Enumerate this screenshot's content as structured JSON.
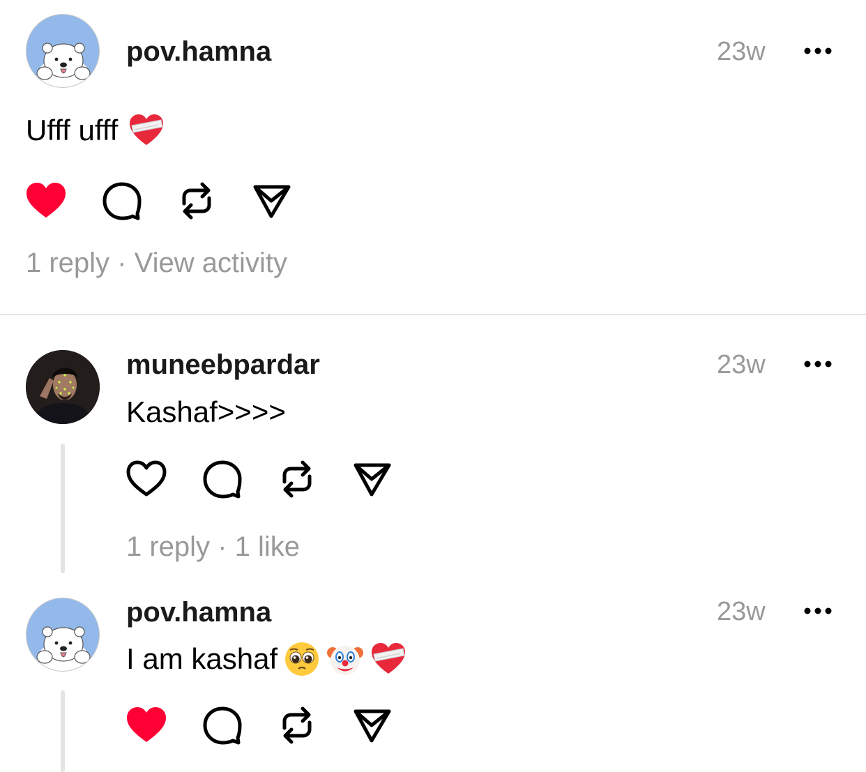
{
  "posts": [
    {
      "username": "pov.hamna",
      "time": "23w",
      "text": "Ufff ufff",
      "emojis": [
        "mending-heart-emoji"
      ],
      "liked": true,
      "meta": "1 reply · View activity",
      "avatar": "polar-bear-avatar"
    },
    {
      "username": "muneebpardar",
      "time": "23w",
      "text": "Kashaf>>>>",
      "emojis": [],
      "liked": false,
      "meta": "1 reply · 1 like",
      "avatar": "profile-photo-avatar"
    },
    {
      "username": "pov.hamna",
      "time": "23w",
      "text": "I am kashaf",
      "emojis": [
        "pleading-face-emoji",
        "clown-face-emoji",
        "mending-heart-emoji"
      ],
      "liked": true,
      "avatar": "polar-bear-avatar"
    }
  ],
  "colors": {
    "like_active": "#ff0034",
    "secondary_text": "#999999",
    "divider": "#e4e4e4",
    "avatar_bg": "#93b9ea"
  },
  "icons": {
    "like": "heart-icon",
    "reply": "comment-bubble-icon",
    "repost": "repost-icon",
    "share": "send-icon",
    "more": "more-dots-icon"
  }
}
